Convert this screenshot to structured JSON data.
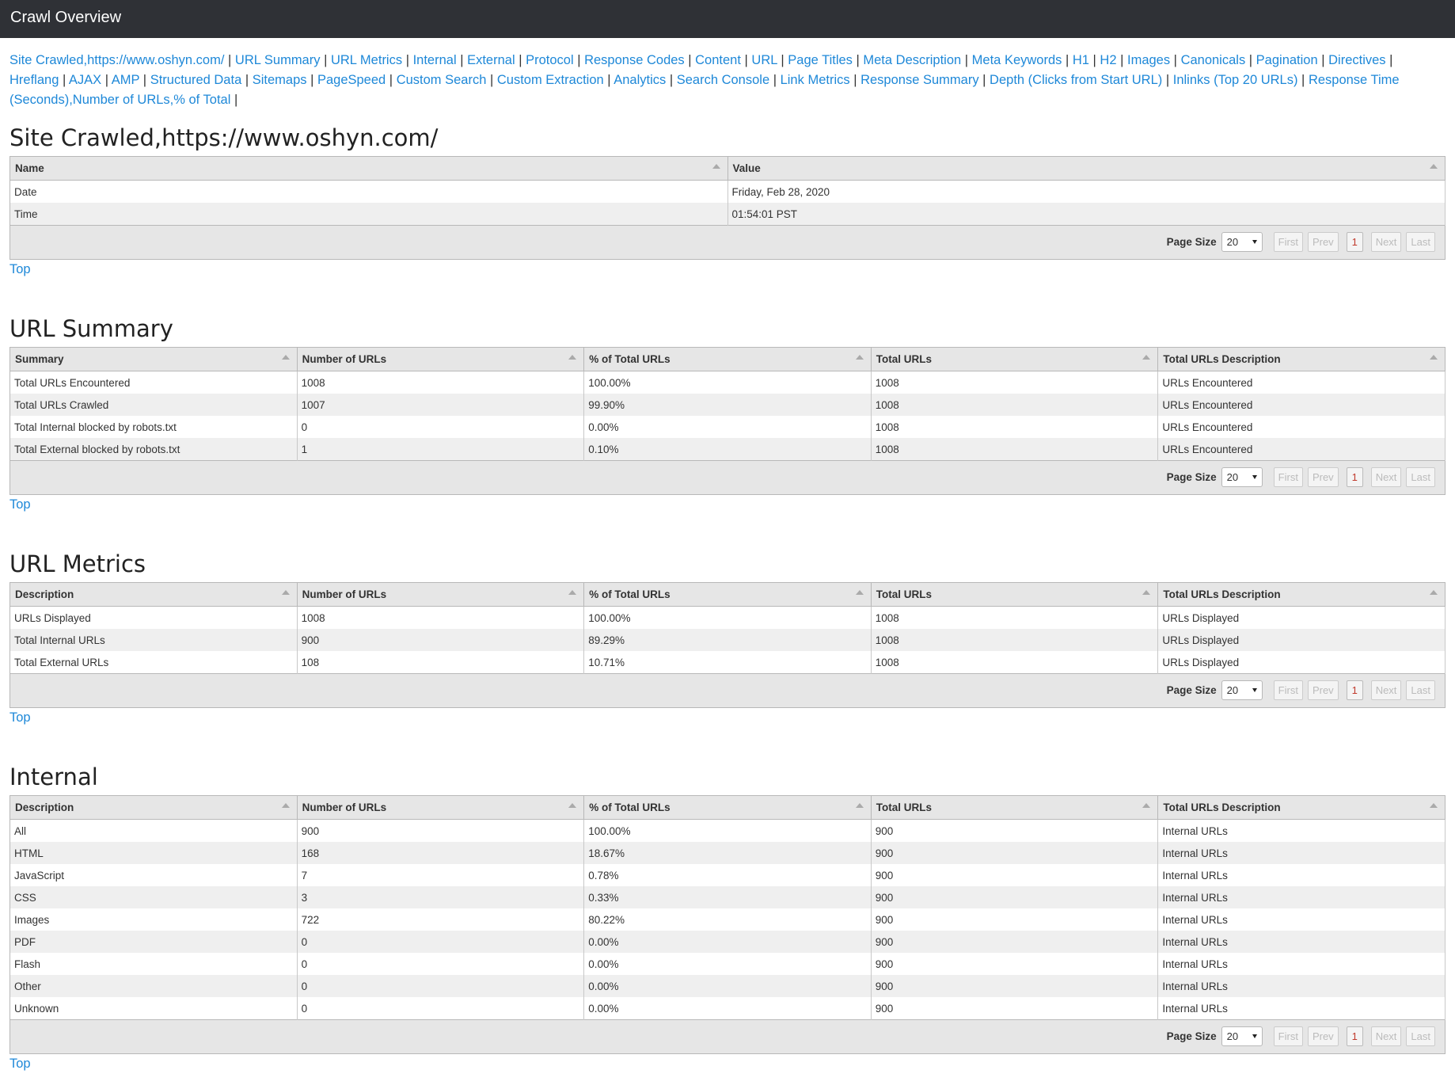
{
  "header": {
    "title": "Crawl Overview"
  },
  "nav": {
    "links": [
      "Site Crawled,https://www.oshyn.com/",
      "URL Summary",
      "URL Metrics",
      "Internal",
      "External",
      "Protocol",
      "Response Codes",
      "Content",
      "URL",
      "Page Titles",
      "Meta Description",
      "Meta Keywords",
      "H1",
      "H2",
      "Images",
      "Canonicals",
      "Pagination",
      "Directives",
      "Hreflang",
      "AJAX",
      "AMP",
      "Structured Data",
      "Sitemaps",
      "PageSpeed",
      "Custom Search",
      "Custom Extraction",
      "Analytics",
      "Search Console",
      "Link Metrics",
      "Response Summary",
      "Depth (Clicks from Start URL)",
      "Inlinks (Top 20 URLs)",
      "Response Time (Seconds),Number of URLs,% of Total"
    ]
  },
  "pager": {
    "label": "Page Size",
    "size": "20",
    "first": "First",
    "prev": "Prev",
    "page": "1",
    "next": "Next",
    "last": "Last"
  },
  "top_label": "Top",
  "sections": [
    {
      "title": "Site Crawled,https://www.oshyn.com/",
      "columns": [
        "Name",
        "Value"
      ],
      "rows": [
        [
          "Date",
          "Friday, Feb 28, 2020"
        ],
        [
          "Time",
          "01:54:01 PST"
        ]
      ]
    },
    {
      "title": "URL Summary",
      "columns": [
        "Summary",
        "Number of URLs",
        "% of Total URLs",
        "Total URLs",
        "Total URLs Description"
      ],
      "rows": [
        [
          "Total URLs Encountered",
          "1008",
          "100.00%",
          "1008",
          "URLs Encountered"
        ],
        [
          "Total URLs Crawled",
          "1007",
          "99.90%",
          "1008",
          "URLs Encountered"
        ],
        [
          "Total Internal blocked by robots.txt",
          "0",
          "0.00%",
          "1008",
          "URLs Encountered"
        ],
        [
          "Total External blocked by robots.txt",
          "1",
          "0.10%",
          "1008",
          "URLs Encountered"
        ]
      ]
    },
    {
      "title": "URL Metrics",
      "columns": [
        "Description",
        "Number of URLs",
        "% of Total URLs",
        "Total URLs",
        "Total URLs Description"
      ],
      "rows": [
        [
          "URLs Displayed",
          "1008",
          "100.00%",
          "1008",
          "URLs Displayed"
        ],
        [
          "Total Internal URLs",
          "900",
          "89.29%",
          "1008",
          "URLs Displayed"
        ],
        [
          "Total External URLs",
          "108",
          "10.71%",
          "1008",
          "URLs Displayed"
        ]
      ]
    },
    {
      "title": "Internal",
      "columns": [
        "Description",
        "Number of URLs",
        "% of Total URLs",
        "Total URLs",
        "Total URLs Description"
      ],
      "rows": [
        [
          "All",
          "900",
          "100.00%",
          "900",
          "Internal URLs"
        ],
        [
          "HTML",
          "168",
          "18.67%",
          "900",
          "Internal URLs"
        ],
        [
          "JavaScript",
          "7",
          "0.78%",
          "900",
          "Internal URLs"
        ],
        [
          "CSS",
          "3",
          "0.33%",
          "900",
          "Internal URLs"
        ],
        [
          "Images",
          "722",
          "80.22%",
          "900",
          "Internal URLs"
        ],
        [
          "PDF",
          "0",
          "0.00%",
          "900",
          "Internal URLs"
        ],
        [
          "Flash",
          "0",
          "0.00%",
          "900",
          "Internal URLs"
        ],
        [
          "Other",
          "0",
          "0.00%",
          "900",
          "Internal URLs"
        ],
        [
          "Unknown",
          "0",
          "0.00%",
          "900",
          "Internal URLs"
        ]
      ]
    }
  ]
}
